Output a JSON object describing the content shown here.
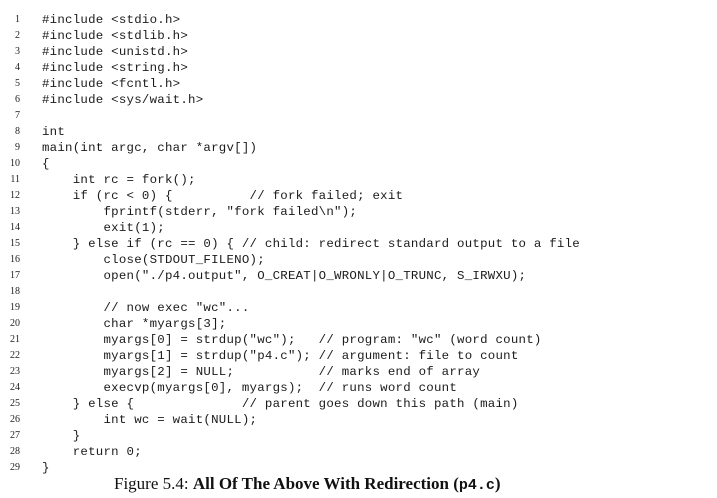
{
  "code_lines": [
    "#include <stdio.h>",
    "#include <stdlib.h>",
    "#include <unistd.h>",
    "#include <string.h>",
    "#include <fcntl.h>",
    "#include <sys/wait.h>",
    "",
    "int",
    "main(int argc, char *argv[])",
    "{",
    "    int rc = fork();",
    "    if (rc < 0) {          // fork failed; exit",
    "        fprintf(stderr, \"fork failed\\n\");",
    "        exit(1);",
    "    } else if (rc == 0) { // child: redirect standard output to a file",
    "        close(STDOUT_FILENO);",
    "        open(\"./p4.output\", O_CREAT|O_WRONLY|O_TRUNC, S_IRWXU);",
    "",
    "        // now exec \"wc\"...",
    "        char *myargs[3];",
    "        myargs[0] = strdup(\"wc\");   // program: \"wc\" (word count)",
    "        myargs[1] = strdup(\"p4.c\"); // argument: file to count",
    "        myargs[2] = NULL;           // marks end of array",
    "        execvp(myargs[0], myargs);  // runs word count",
    "    } else {              // parent goes down this path (main)",
    "        int wc = wait(NULL);",
    "    }",
    "    return 0;",
    "}"
  ],
  "caption": {
    "label": "Figure 5.4: ",
    "title": "All Of The Above With Redirection (",
    "file": "p4.c",
    "close": ")"
  }
}
